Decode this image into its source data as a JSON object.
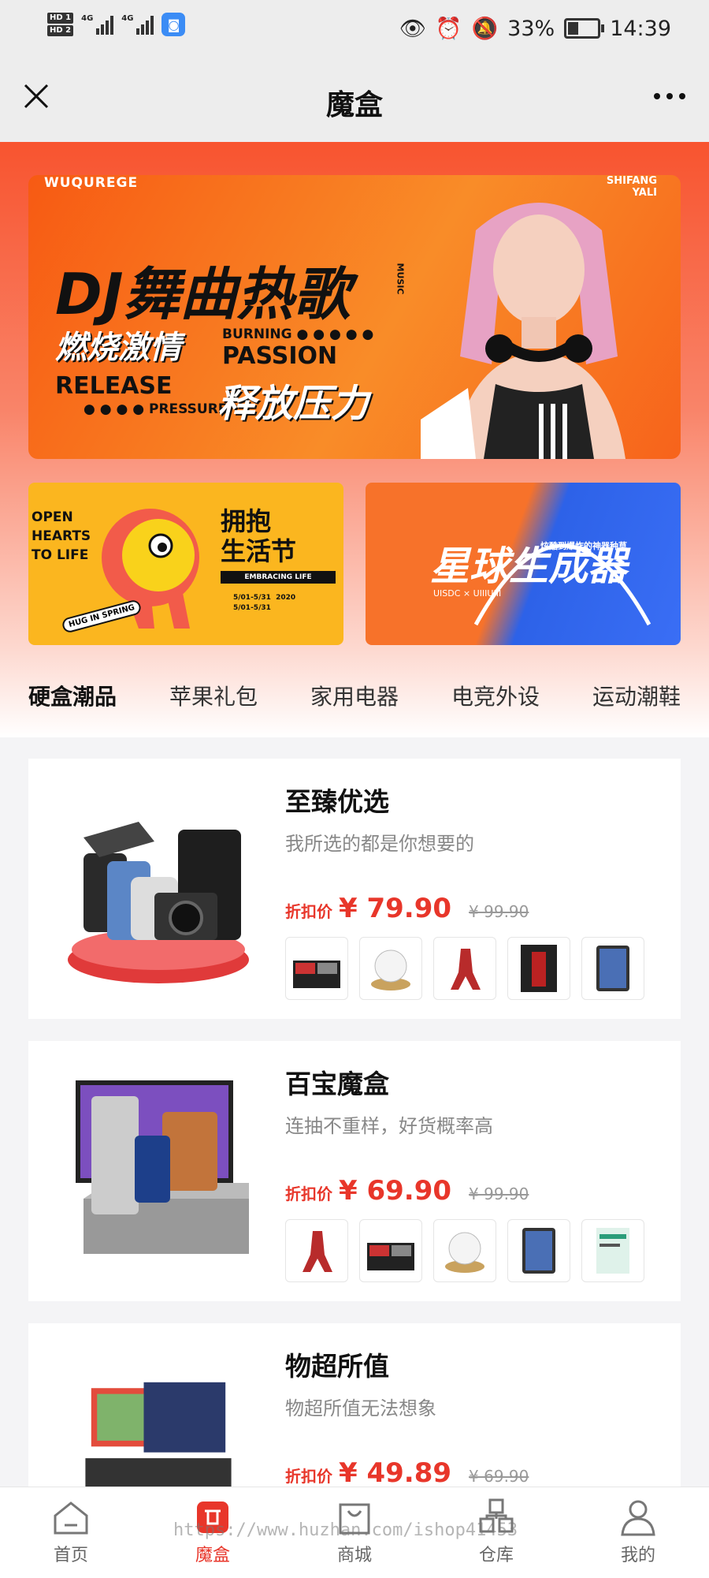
{
  "status_bar": {
    "hd1": "HD 1",
    "hd2": "HD 2",
    "sig1": "4G",
    "sig2": "4G",
    "battery": "33%",
    "time": "14:39"
  },
  "title_bar": {
    "title": "魔盒"
  },
  "banner_main": {
    "top_left": "WUQUREGE",
    "top_right1": "SHIFANG",
    "top_right2": "YALI",
    "line1": "DJ舞曲热歌",
    "line2": "燃烧激情",
    "burning": "BURNING ● ● ● ● ●",
    "passion": "PASSION",
    "release": "RELEASE",
    "pressure": "● ● ● ● PRESSURE",
    "line3": "释放压力",
    "music": "MUSIC"
  },
  "banner_sub1": {
    "text_en": "OPEN\nHEARTS\nTO LIFE",
    "hug": "HUG IN SPRING",
    "big": "拥抱\n生活节",
    "en": "EMBRACING LIFE",
    "dates": "5/01-5/31  2020\n5/01-5/31"
  },
  "banner_sub2": {
    "main": "星球生成器",
    "small": "炫酷到爆炸的神器种草",
    "sub": "UISDC × UIIIUIII"
  },
  "tabs": [
    "硬盒潮品",
    "苹果礼包",
    "家用电器",
    "电竞外设",
    "运动潮鞋"
  ],
  "cards": [
    {
      "title": "至臻优选",
      "subtitle": "我所选的都是你想要的",
      "price_label": "折扣价",
      "price": "¥ 79.90",
      "original": "¥ 99.90"
    },
    {
      "title": "百宝魔盒",
      "subtitle": "连抽不重样，好货概率高",
      "price_label": "折扣价",
      "price": "¥ 69.90",
      "original": "¥ 99.90"
    },
    {
      "title": "物超所值",
      "subtitle": "物超所值无法想象",
      "price_label": "折扣价",
      "price": "¥ 49.89",
      "original": "¥ 69.90"
    }
  ],
  "nav": [
    "首页",
    "魔盒",
    "商城",
    "仓库",
    "我的"
  ],
  "watermark": "https://www.huzhan.com/ishop41453",
  "colors": {
    "accent": "#e8362a",
    "hero": "#f8542f"
  }
}
